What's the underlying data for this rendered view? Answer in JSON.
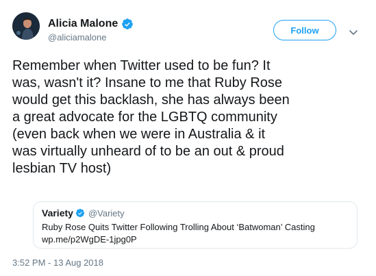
{
  "author": {
    "display_name": "Alicia Malone",
    "handle": "@aliciamalone",
    "verified": true,
    "avatar": "avatar-image"
  },
  "actions": {
    "follow_label": "Follow",
    "more_icon": "chevron-down-icon"
  },
  "tweet": {
    "text": "Remember when Twitter used to be fun? It\nwas, wasn't it? Insane to me that Ruby Rose\nwould get this backlash, she has always been\na great advocate for the LGBTQ community\n(even back when we were in Australia & it\nwas virtually unheard of to be an out & proud\nlesbian TV host)",
    "timestamp": "3:52 PM - 13 Aug 2018"
  },
  "quoted_tweet": {
    "display_name": "Variety",
    "handle": "@Variety",
    "verified": true,
    "text": "Ruby Rose Quits Twitter Following Trolling About ‘Batwoman’ Casting\nwp.me/p2WgDE-1jpg0P"
  },
  "colors": {
    "accent": "#1da1f2",
    "text": "#14171a",
    "secondary_text": "#657786",
    "border": "#e1e8ed"
  }
}
